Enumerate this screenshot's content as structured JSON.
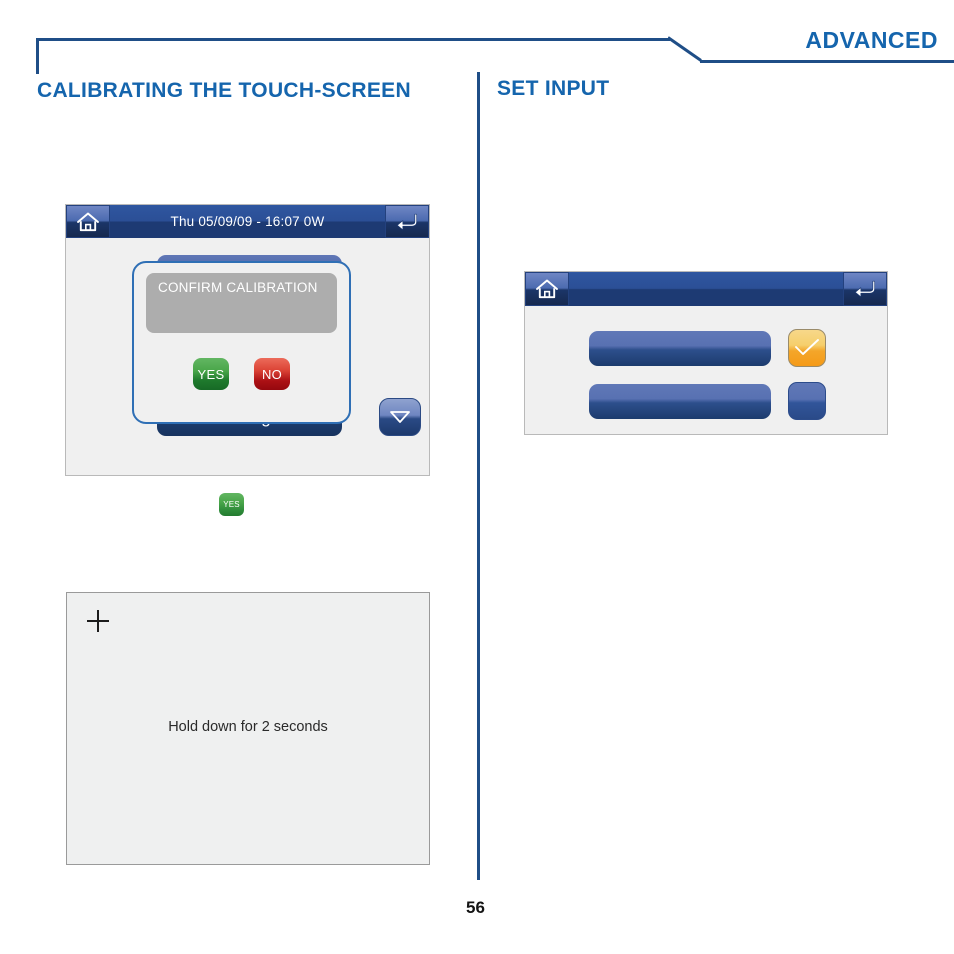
{
  "header": {
    "title": "ADVANCED"
  },
  "sections": {
    "left": {
      "heading": "CALIBRATING THE TOUCH-SCREEN"
    },
    "right": {
      "heading": "SET INPUT"
    }
  },
  "calibration_device": {
    "titlebar": {
      "home_icon": "home-icon",
      "status_text": "Thu 05/09/09 - 16:07   0W",
      "back_icon": "enter-return-icon"
    },
    "background_button": "Reset configuration",
    "scroll_icon": "chevron-down-icon",
    "modal": {
      "message": "CONFIRM CALIBRATION",
      "yes_label": "YES",
      "no_label": "NO"
    }
  },
  "mini_badge": {
    "label": "YES"
  },
  "calibration_screen": {
    "crosshair_icon": "crosshair-icon",
    "instruction": "Hold down for 2 seconds"
  },
  "input_device": {
    "titlebar": {
      "home_icon": "home-icon",
      "status_text": "",
      "back_icon": "enter-return-icon"
    },
    "rows": [
      {
        "bar_label": "",
        "action_icon": "checkmark-icon"
      },
      {
        "bar_label": "",
        "action_icon": "blank-button-icon"
      }
    ]
  },
  "footer": {
    "page_number": "56"
  },
  "colors": {
    "accent_blue": "#1565ad",
    "rule_blue": "#1f4e87",
    "titlebar_blue": "#1d3a73",
    "button_blue": "#2d4f8c",
    "yes_green": "#1f7a2d",
    "no_red": "#ab1014",
    "check_orange": "#f4a62a",
    "message_gray": "#adadad"
  }
}
